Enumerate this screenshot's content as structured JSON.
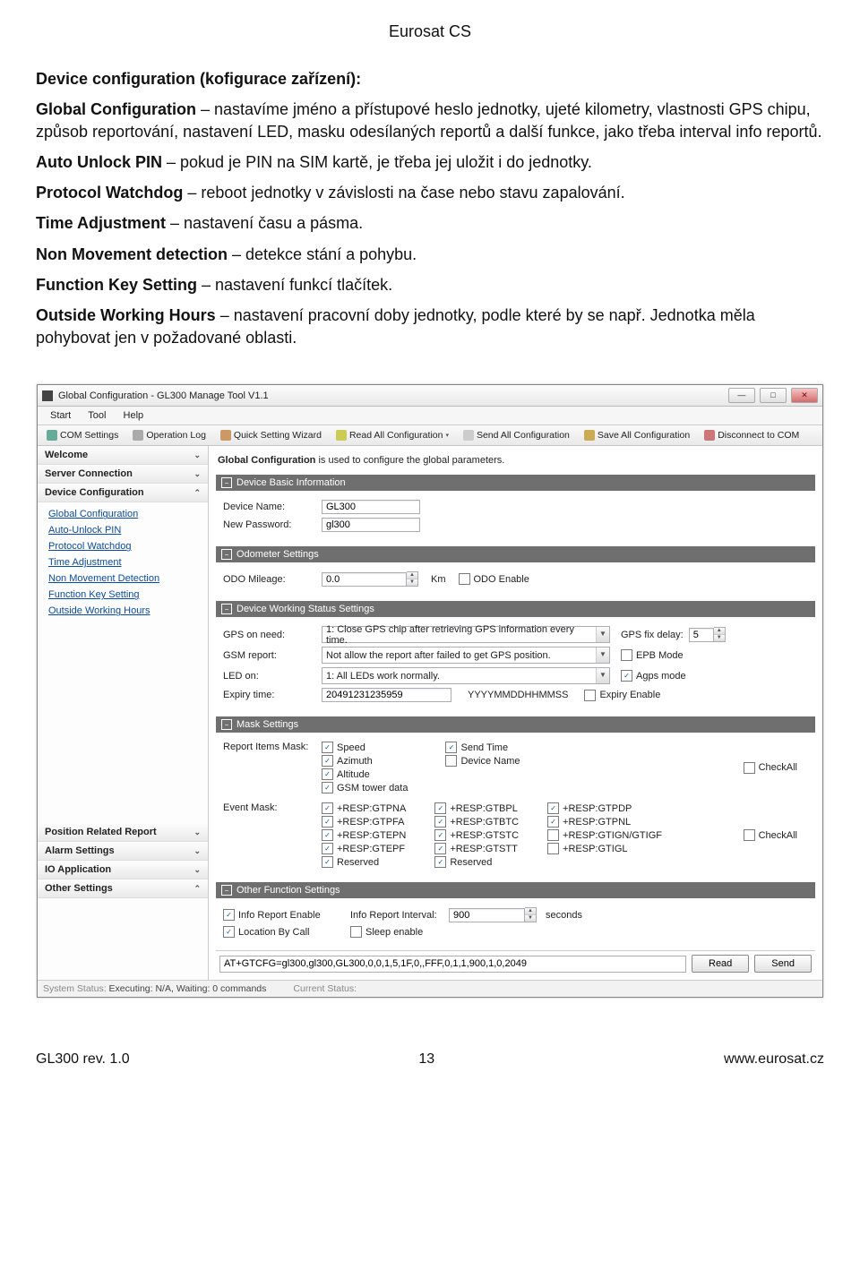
{
  "page": {
    "header": "Eurosat CS",
    "footer_left": "GL300 rev. 1.0",
    "footer_center": "13",
    "footer_right": "www.eurosat.cz",
    "heading": "Device configuration (kofigurace zařízení):",
    "para_global_b": "Global Configuration",
    "para_global_t": " – nastavíme jméno a přístupové heslo jednotky, ujeté kilometry, vlastnosti GPS chipu, způsob reportování, nastavení LED, masku odesílaných reportů a další funkce, jako třeba interval info reportů.",
    "para_auto_b": "Auto Unlock PIN",
    "para_auto_t": " – pokud je PIN na SIM kartě, je třeba jej uložit i do jednotky.",
    "para_pw_b": "Protocol Watchdog",
    "para_pw_t": " – reboot jednotky v závislosti na čase nebo stavu zapalování.",
    "para_ta_b": "Time Adjustment",
    "para_ta_t": " – nastavení času a pásma.",
    "para_nm_b": "Non Movement detection",
    "para_nm_t": " – detekce stání a pohybu.",
    "para_fk_b": "Function Key Setting",
    "para_fk_t": " – nastavení funkcí tlačítek.",
    "para_ow_b": "Outside Working Hours",
    "para_ow_t": " – nastavení pracovní doby jednotky, podle které by se např. Jednotka měla pohybovat jen v požadované oblasti."
  },
  "app": {
    "title": "Global Configuration - GL300 Manage Tool V1.1",
    "menu": {
      "start": "Start",
      "tool": "Tool",
      "help": "Help"
    },
    "toolbar": {
      "com": "COM Settings",
      "log": "Operation Log",
      "wiz": "Quick Setting Wizard",
      "read": "Read All Configuration",
      "send": "Send All Configuration",
      "save": "Save All Configuration",
      "disc": "Disconnect to COM"
    },
    "sidebar": {
      "welcome": "Welcome",
      "server": "Server Connection",
      "devconf": "Device Configuration",
      "links": {
        "global": "Global Configuration",
        "auto": "Auto-Unlock PIN",
        "pw": "Protocol Watchdog",
        "ta": "Time Adjustment",
        "nm": "Non Movement Detection",
        "fk": "Function Key Setting",
        "ow": "Outside Working Hours"
      },
      "pos": "Position Related Report",
      "alarm": "Alarm Settings",
      "io": "IO Application",
      "other": "Other Settings"
    },
    "content": {
      "desc_b": "Global Configuration",
      "desc_t": "   is used to configure the global parameters.",
      "sec_basic": "Device Basic Information",
      "device_name_l": "Device Name:",
      "device_name_v": "GL300",
      "new_pw_l": "New Password:",
      "new_pw_v": "gl300",
      "sec_odo": "Odometer Settings",
      "odo_l": "ODO Mileage:",
      "odo_v": "0.0",
      "odo_unit": "Km",
      "odo_enable": "ODO Enable",
      "sec_work": "Device Working Status Settings",
      "gps_l": "GPS on need:",
      "gps_v": "1: Close GPS chip after retrieving GPS information every time.",
      "gps_fix_l": "GPS fix delay:",
      "gps_fix_v": "5",
      "gsm_l": "GSM report:",
      "gsm_v": "Not allow the report after failed to get GPS position.",
      "epb": "EPB Mode",
      "led_l": "LED on:",
      "led_v": "1: All LEDs work normally.",
      "agps": "Agps mode",
      "exp_l": "Expiry time:",
      "exp_v": "20491231235959",
      "exp_fmt": "YYYYMMDDHHMMSS",
      "exp_enable": "Expiry Enable",
      "sec_mask": "Mask Settings",
      "rim_l": "Report Items Mask:",
      "rim": {
        "speed": "Speed",
        "azimuth": "Azimuth",
        "altitude": "Altitude",
        "gsm": "GSM tower data",
        "sendtime": "Send Time",
        "devname": "Device Name"
      },
      "checkall": "CheckAll",
      "em_l": "Event Mask:",
      "em_c1": [
        "+RESP:GTPNA",
        "+RESP:GTPFA",
        "+RESP:GTEPN",
        "+RESP:GTEPF",
        "Reserved"
      ],
      "em_c2": [
        "+RESP:GTBPL",
        "+RESP:GTBTC",
        "+RESP:GTSTC",
        "+RESP:GTSTT",
        "Reserved"
      ],
      "em_c3": [
        "+RESP:GTPDP",
        "+RESP:GTPNL",
        "+RESP:GTIGN/GTIGF",
        "+RESP:GTIGL"
      ],
      "sec_other": "Other Function Settings",
      "info_enable": "Info Report Enable",
      "loc_call": "Location By Call",
      "info_int_l": "Info Report Interval:",
      "info_int_v": "900",
      "seconds": "seconds",
      "sleep": "Sleep enable",
      "cmd": "AT+GTCFG=gl300,gl300,GL300,0,0,1,5,1F,0,,FFF,0,1,1,900,1,0,2049",
      "read_btn": "Read",
      "send_btn": "Send",
      "status_l": "System Status:",
      "status_v": "Executing: N/A, Waiting: 0 commands",
      "status_c": "Current Status:"
    }
  }
}
